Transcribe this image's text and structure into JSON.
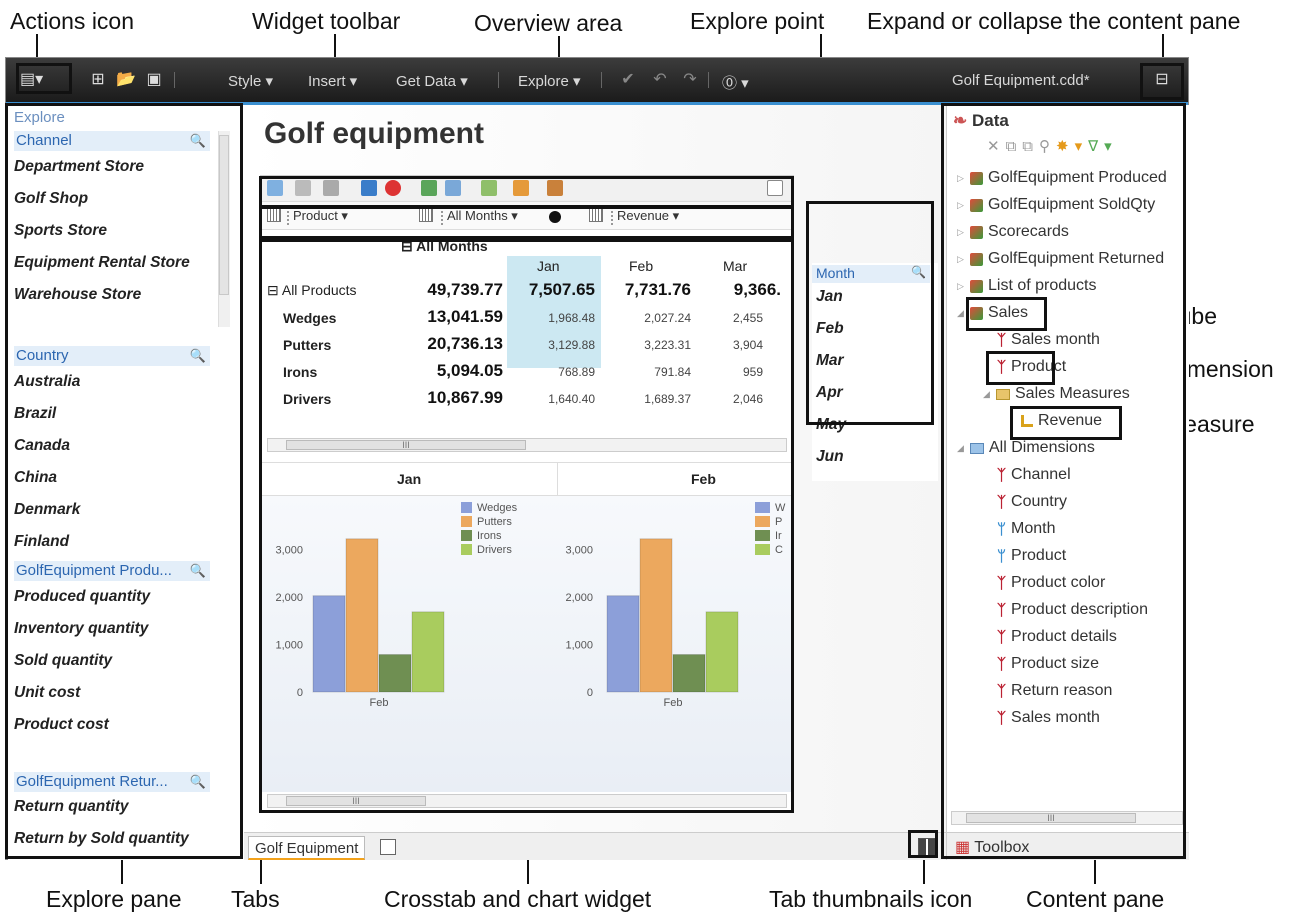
{
  "callouts": {
    "actions_icon": "Actions icon",
    "widget_toolbar": "Widget toolbar",
    "overview_area": "Overview area",
    "explore_point": "Explore point",
    "expand_collapse": "Expand or collapse the content pane",
    "cube": "Cube",
    "dimension": "Dimension",
    "measure": "Measure",
    "explore_pane": "Explore pane",
    "tabs": "Tabs",
    "crosstab_chart_widget": "Crosstab and chart widget",
    "tab_thumbnails_icon": "Tab thumbnails icon",
    "content_pane": "Content pane"
  },
  "menubar": {
    "style": "Style ▾",
    "insert": "Insert ▾",
    "get_data": "Get Data ▾",
    "explore": "Explore ▾",
    "help": "⓪ ▾",
    "document_title": "Golf Equipment.cdd*"
  },
  "explore_pane": {
    "title": "Explore",
    "groups": [
      {
        "header": "Channel",
        "items": [
          "Department Store",
          "Golf Shop",
          "Sports Store",
          "Equipment Rental Store",
          "Warehouse Store"
        ]
      },
      {
        "header": "Country",
        "items": [
          "Australia",
          "Brazil",
          "Canada",
          "China",
          "Denmark",
          "Finland"
        ]
      },
      {
        "header": "GolfEquipment Produ...",
        "items": [
          "Produced quantity",
          "Inventory quantity",
          "Sold quantity",
          "Unit cost",
          "Product cost"
        ]
      },
      {
        "header": "GolfEquipment Retur...",
        "items": [
          "Return quantity",
          "Return by Sold quantity"
        ]
      }
    ]
  },
  "canvas": {
    "page_title": "Golf equipment"
  },
  "overview": {
    "product": "Product ▾",
    "all_months": "All Months ▾",
    "revenue": "Revenue ▾"
  },
  "crosstab": {
    "col_group": "All Months",
    "columns": [
      "Jan",
      "Feb",
      "Mar"
    ],
    "rows": [
      {
        "label": "All Products",
        "total": "49,739.77",
        "values": [
          "7,507.65",
          "7,731.76",
          "9,366."
        ]
      },
      {
        "label": "Wedges",
        "total": "13,041.59",
        "values": [
          "1,968.48",
          "2,027.24",
          "2,455"
        ]
      },
      {
        "label": "Putters",
        "total": "20,736.13",
        "values": [
          "3,129.88",
          "3,223.31",
          "3,904"
        ]
      },
      {
        "label": "Irons",
        "total": "5,094.05",
        "values": [
          "768.89",
          "791.84",
          "959"
        ]
      },
      {
        "label": "Drivers",
        "total": "10,867.99",
        "values": [
          "1,640.40",
          "1,689.37",
          "2,046"
        ]
      }
    ],
    "scroll_mark": "III"
  },
  "chart_headers": [
    "Jan",
    "Feb"
  ],
  "chart_data": [
    {
      "type": "bar",
      "title": "Jan",
      "categories": [
        "Feb"
      ],
      "series": [
        {
          "name": "Wedges",
          "values": [
            2030
          ]
        },
        {
          "name": "Putters",
          "values": [
            3230
          ]
        },
        {
          "name": "Irons",
          "values": [
            790
          ]
        },
        {
          "name": "Drivers",
          "values": [
            1690
          ]
        }
      ],
      "ylim": [
        0,
        3500
      ],
      "yticks": [
        "0",
        "1,000",
        "2,000",
        "3,000"
      ],
      "legend": "top-right",
      "colors": [
        "#8c9fd9",
        "#eca85e",
        "#6f8f52",
        "#a9cc5e"
      ]
    },
    {
      "type": "bar",
      "title": "Feb",
      "categories": [
        "Feb"
      ],
      "series": [
        {
          "name": "Wedges",
          "values": [
            2030
          ]
        },
        {
          "name": "Putters",
          "values": [
            3230
          ]
        },
        {
          "name": "Irons",
          "values": [
            790
          ]
        },
        {
          "name": "Drivers",
          "values": [
            1690
          ]
        }
      ],
      "ylim": [
        0,
        3500
      ],
      "yticks": [
        "0",
        "1,000",
        "2,000",
        "3,000"
      ],
      "legend": "top-right",
      "colors": [
        "#8c9fd9",
        "#eca85e",
        "#6f8f52",
        "#a9cc5e"
      ]
    }
  ],
  "chart_legend_truncated": [
    "W",
    "P",
    "Ir",
    "C"
  ],
  "month_list": {
    "header": "Month",
    "items": [
      "Jan",
      "Feb",
      "Mar",
      "Apr",
      "May",
      "Jun"
    ]
  },
  "content_pane": {
    "title": "Data",
    "tree": [
      {
        "label": "GolfEquipment Produced",
        "kind": "cube"
      },
      {
        "label": "GolfEquipment SoldQty",
        "kind": "cube"
      },
      {
        "label": "Scorecards",
        "kind": "cube"
      },
      {
        "label": "GolfEquipment Returned",
        "kind": "cube"
      },
      {
        "label": "List of products",
        "kind": "cube"
      },
      {
        "label": "Sales",
        "kind": "cube"
      },
      {
        "label": "Sales month",
        "kind": "dim"
      },
      {
        "label": "Product",
        "kind": "dim"
      },
      {
        "label": "Sales Measures",
        "kind": "folder"
      },
      {
        "label": "Revenue",
        "kind": "measure"
      },
      {
        "label": "All Dimensions",
        "kind": "folder"
      },
      {
        "label": "Channel",
        "kind": "dim"
      },
      {
        "label": "Country",
        "kind": "dim"
      },
      {
        "label": "Month",
        "kind": "hier"
      },
      {
        "label": "Product",
        "kind": "hier"
      },
      {
        "label": "Product color",
        "kind": "dim"
      },
      {
        "label": "Product description",
        "kind": "dim"
      },
      {
        "label": "Product details",
        "kind": "dim"
      },
      {
        "label": "Product size",
        "kind": "dim"
      },
      {
        "label": "Return reason",
        "kind": "dim"
      },
      {
        "label": "Sales month",
        "kind": "dim"
      }
    ],
    "toolbox": "Toolbox",
    "scroll_mark": "III"
  },
  "tabs": {
    "tab_label": "Golf Equipment"
  }
}
